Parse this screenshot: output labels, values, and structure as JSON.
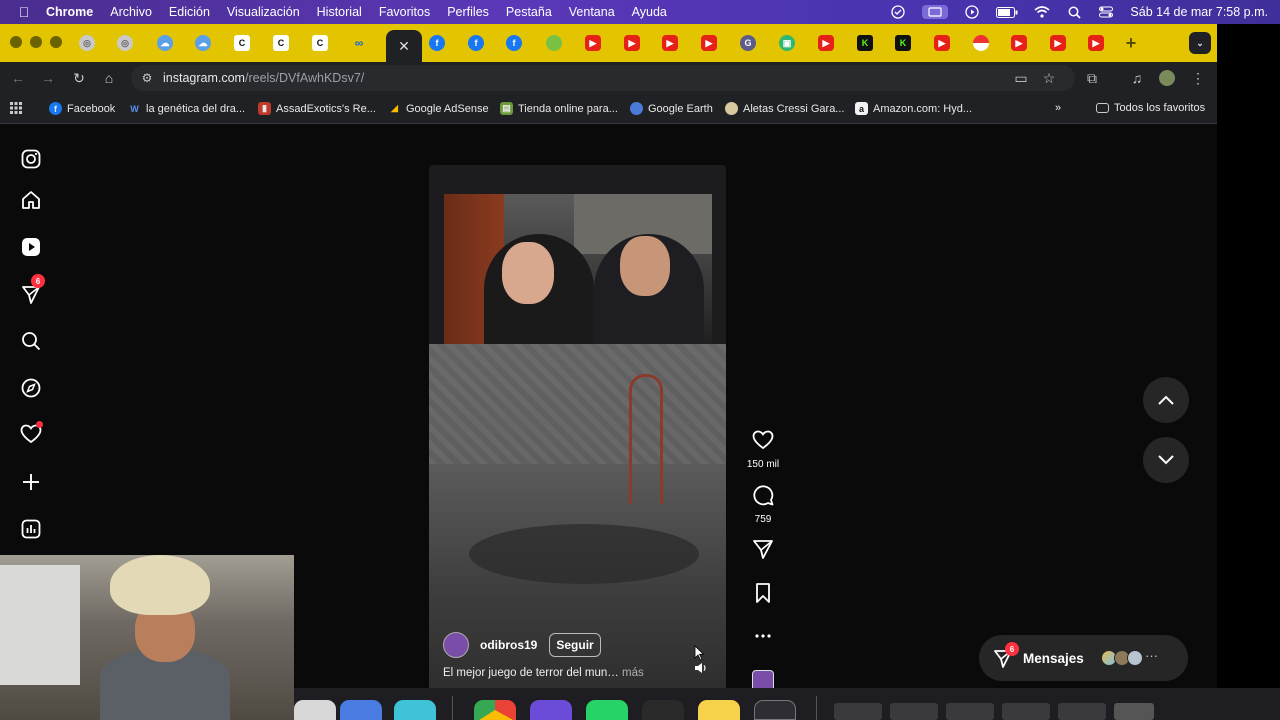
{
  "menubar": {
    "app_name": "Chrome",
    "items": [
      "Archivo",
      "Edición",
      "Visualización",
      "Historial",
      "Favoritos",
      "Perfiles",
      "Pestaña",
      "Ventana",
      "Ayuda"
    ],
    "clock": "Sáb 14 de mar  7:58 p.m."
  },
  "browser": {
    "url_domain": "instagram.com",
    "url_path": "/reels/DVfAwhKDsv7/",
    "bookmarks": [
      {
        "label": "Facebook",
        "icon": "facebook-icon",
        "color": "#1877f2"
      },
      {
        "label": "la genética del dra...",
        "icon": "w-icon",
        "color": "#2d63d8"
      },
      {
        "label": "AssadExotics's Re...",
        "icon": "chart-icon",
        "color": "#c0392b"
      },
      {
        "label": "Google AdSense",
        "icon": "adsense-icon",
        "color": "#fbbc04"
      },
      {
        "label": "Tienda online para...",
        "icon": "store-icon",
        "color": "#6a9a3a"
      },
      {
        "label": "Google Earth",
        "icon": "earth-icon",
        "color": "#4a7bd8"
      },
      {
        "label": "Aletas Cressi Gara...",
        "icon": "fin-icon",
        "color": "#d8c8a0"
      },
      {
        "label": "Amazon.com: Hyd...",
        "icon": "amazon-icon",
        "color": "#f3f3f3"
      }
    ],
    "all_bookmarks": "Todos los favoritos"
  },
  "instagram": {
    "notifications_badge": "6",
    "reel": {
      "username": "odibros19",
      "follow_label": "Seguir",
      "caption": "El mejor juego de terror del mun…",
      "more_label": "más",
      "likes": "150 mil",
      "comments": "759"
    },
    "messages": {
      "label": "Mensajes",
      "badge": "6"
    }
  },
  "colors": {
    "tabstrip": "#e3c400",
    "accent_red": "#ff3040",
    "menubar": "#5a38b8"
  }
}
